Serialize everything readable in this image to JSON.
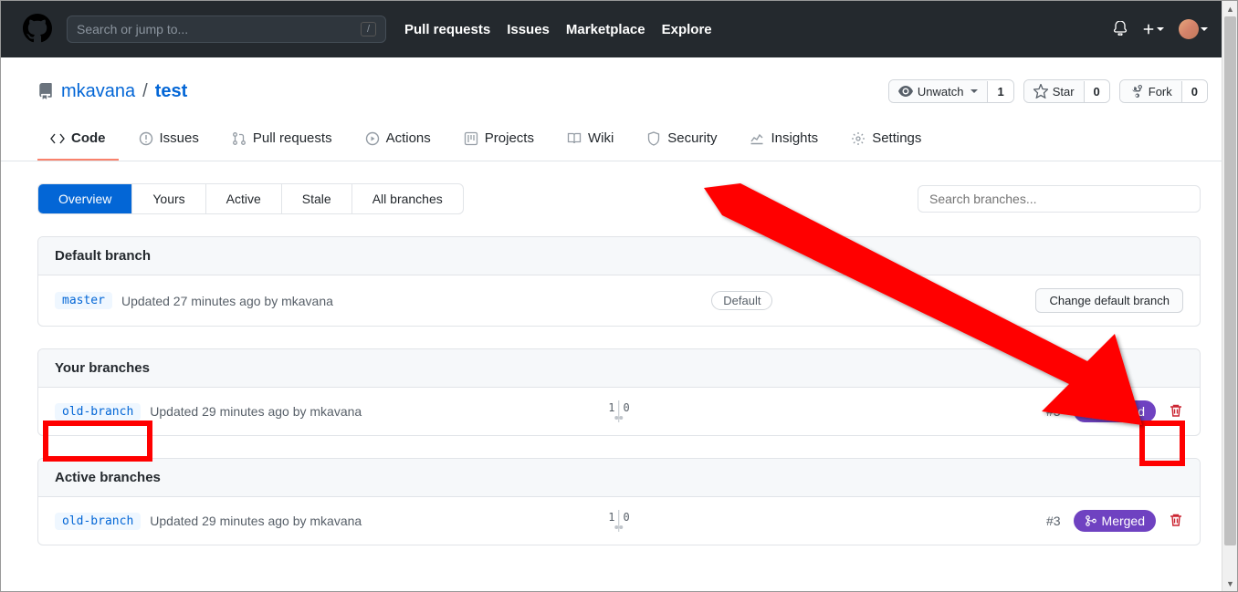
{
  "header": {
    "search_placeholder": "Search or jump to...",
    "slash": "/",
    "nav": {
      "pulls": "Pull requests",
      "issues": "Issues",
      "marketplace": "Marketplace",
      "explore": "Explore"
    }
  },
  "repo": {
    "owner": "mkavana",
    "name": "test",
    "sep": "/",
    "watch": {
      "label": "Unwatch",
      "count": "1"
    },
    "star": {
      "label": "Star",
      "count": "0"
    },
    "fork": {
      "label": "Fork",
      "count": "0"
    }
  },
  "tabs": {
    "code": "Code",
    "issues": "Issues",
    "pulls": "Pull requests",
    "actions": "Actions",
    "projects": "Projects",
    "wiki": "Wiki",
    "security": "Security",
    "insights": "Insights",
    "settings": "Settings"
  },
  "filters": {
    "overview": "Overview",
    "yours": "Yours",
    "active": "Active",
    "stale": "Stale",
    "all": "All branches",
    "search_placeholder": "Search branches..."
  },
  "sections": {
    "default": {
      "title": "Default branch",
      "branch": "master",
      "meta": "Updated 27 minutes ago by mkavana",
      "badge": "Default",
      "change_btn": "Change default branch"
    },
    "yours": {
      "title": "Your branches",
      "branch": "old-branch",
      "meta": "Updated 29 minutes ago by mkavana",
      "behind": "1",
      "ahead": "0",
      "pr": "#3",
      "status": "Merged"
    },
    "active": {
      "title": "Active branches",
      "branch": "old-branch",
      "meta": "Updated 29 minutes ago by mkavana",
      "behind": "1",
      "ahead": "0",
      "pr": "#3",
      "status": "Merged"
    }
  }
}
